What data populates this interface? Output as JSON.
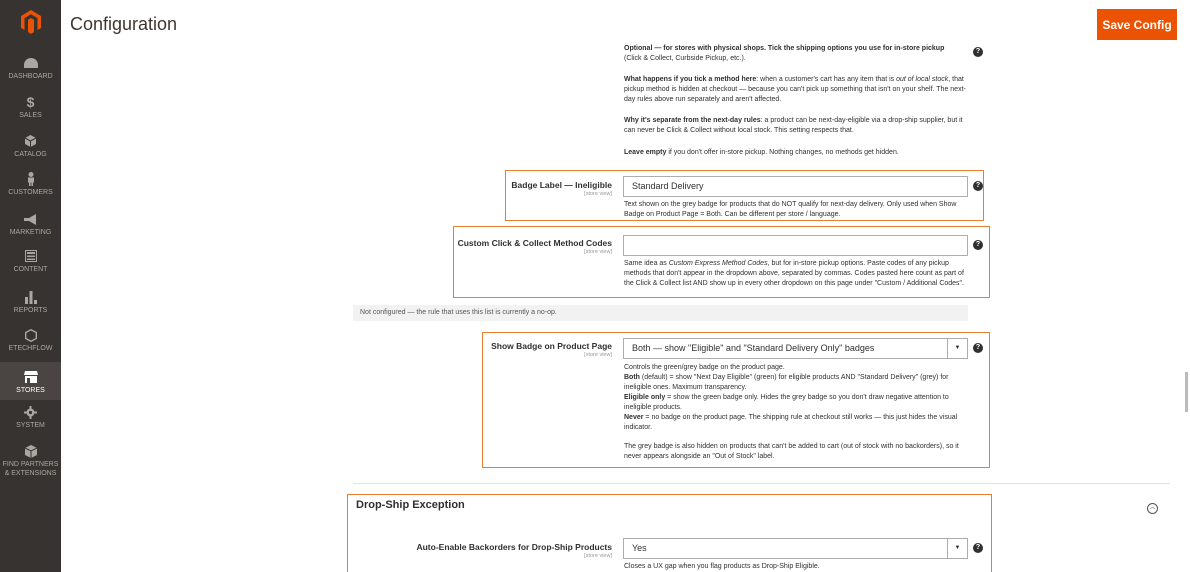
{
  "header": {
    "title": "Configuration",
    "save_label": "Save Config"
  },
  "sidebar": {
    "items": [
      {
        "label": "DASHBOARD",
        "icon": "dashboard-icon"
      },
      {
        "label": "SALES",
        "icon": "dollar-icon"
      },
      {
        "label": "CATALOG",
        "icon": "cube-icon"
      },
      {
        "label": "CUSTOMERS",
        "icon": "person-icon"
      },
      {
        "label": "MARKETING",
        "icon": "megaphone-icon"
      },
      {
        "label": "CONTENT",
        "icon": "layout-icon"
      },
      {
        "label": "REPORTS",
        "icon": "bar-chart-icon"
      },
      {
        "label": "ETECHFLOW",
        "icon": "hexagon-icon"
      },
      {
        "label": "STORES",
        "icon": "storefront-icon"
      },
      {
        "label": "SYSTEM",
        "icon": "gear-icon"
      },
      {
        "label": "FIND PARTNERS & EXTENSIONS",
        "icon": "box-icon"
      }
    ]
  },
  "top_notes": {
    "optional_line1": "Optional — for stores with physical shops. Tick the shipping options you use for in-store pickup",
    "optional_line2": "(Click & Collect, Curbside Pickup, etc.).",
    "what_bold": "What happens if you tick a method here",
    "what_text1": ": when a customer's cart has any item that is ",
    "what_italic": "out of local stock",
    "what_text2": ", that pickup method is hidden at checkout — because you can't pick up something that isn't on your shelf. The next-day rules above run separately and aren't affected.",
    "why_bold": "Why it's separate from the next-day rules",
    "why_text": ": a product can be next-day-eligible via a drop-ship supplier, but it can never be Click & Collect without local stock. This setting respects that.",
    "leave_bold": "Leave empty",
    "leave_text": " if you don't offer in-store pickup. Nothing changes, no methods get hidden."
  },
  "badge_label": {
    "label": "Badge Label — Ineligible",
    "scope": "[store view]",
    "value": "Standard Delivery",
    "note": "Text shown on the grey badge for products that do NOT qualify for next-day delivery. Only used when Show Badge on Product Page = Both. Can be different per store / language."
  },
  "custom_codes": {
    "label": "Custom Click & Collect Method Codes",
    "scope": "[store view]",
    "value": "",
    "note_pre": "Same idea as ",
    "note_italic": "Custom Express Method Codes",
    "note_post": ", but for in-store pickup options. Paste codes of any pickup methods that don't appear in the dropdown above, separated by commas. Codes pasted here count as part of the Click & Collect list AND show up in every other dropdown on this page under \"Custom / Additional Codes\"."
  },
  "not_configured": "Not configured — the rule that uses this list is currently a no-op.",
  "show_badge": {
    "label": "Show Badge on Product Page",
    "scope": "[store view]",
    "value": "Both — show \"Eligible\" and \"Standard Delivery Only\" badges",
    "note_intro": "Controls the green/grey badge on the product page.",
    "both_bold": "Both",
    "both_text": " (default) = show \"Next Day Eligible\" (green) for eligible products AND \"Standard Delivery\" (grey) for ineligible ones. Maximum transparency.",
    "eligible_bold": "Eligible only",
    "eligible_text": " = show the green badge only. Hides the grey badge so you don't draw negative attention to ineligible products.",
    "never_bold": "Never",
    "never_text": " = no badge on the product page. The shipping rule at checkout still works — this just hides the visual indicator.",
    "grey_text": "The grey badge is also hidden on products that can't be added to cart (out of stock with no backorders), so it never appears alongside an \"Out of Stock\" label."
  },
  "dropship": {
    "section_title": "Drop-Ship Exception",
    "label": "Auto-Enable Backorders for Drop-Ship Products",
    "scope": "[store view]",
    "value": "Yes",
    "note": "Closes a UX gap when you flag products as Drop-Ship Eligible."
  },
  "colors": {
    "accent": "#eb5202",
    "highlight": "#eb7d31",
    "sidebar": "#373330"
  }
}
